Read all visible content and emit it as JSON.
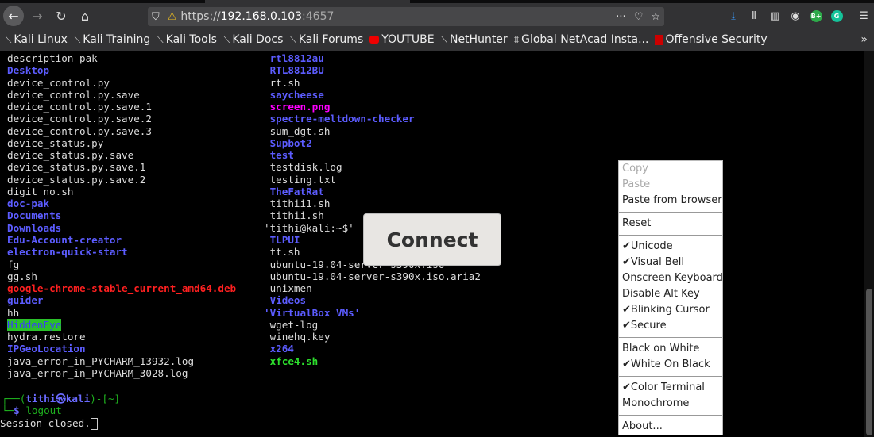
{
  "browser": {
    "url_scheme": "https://",
    "url_host": "192.168.0.103",
    "url_port": ":4657",
    "bookmarks": [
      {
        "label": "Kali Linux",
        "icon": "kali-icon"
      },
      {
        "label": "Kali Training",
        "icon": "kali-icon"
      },
      {
        "label": "Kali Tools",
        "icon": "kali-icon"
      },
      {
        "label": "Kali Docs",
        "icon": "kali-icon"
      },
      {
        "label": "Kali Forums",
        "icon": "kali-icon"
      },
      {
        "label": "YOUTUBE",
        "icon": "youtube-icon"
      },
      {
        "label": "NetHunter",
        "icon": "kali-icon"
      },
      {
        "label": "Global NetAcad Insta...",
        "icon": "netacad-icon"
      },
      {
        "label": "Offensive Security",
        "icon": "offsec-icon"
      }
    ]
  },
  "terminal": {
    "col1": [
      [
        "description-pak",
        ""
      ],
      [
        "Desktop",
        "dir"
      ],
      [
        "device_control.py",
        ""
      ],
      [
        "device_control.py.save",
        ""
      ],
      [
        "device_control.py.save.1",
        ""
      ],
      [
        "device_control.py.save.2",
        ""
      ],
      [
        "device_control.py.save.3",
        ""
      ],
      [
        "device_status.py",
        ""
      ],
      [
        "device_status.py.save",
        ""
      ],
      [
        "device_status.py.save.1",
        ""
      ],
      [
        "device_status.py.save.2",
        ""
      ],
      [
        "digit_no.sh",
        ""
      ],
      [
        "doc-pak",
        "dir"
      ],
      [
        "Documents",
        "dir"
      ],
      [
        "Downloads",
        "dir"
      ],
      [
        "Edu-Account-creator",
        "dir"
      ],
      [
        "electron-quick-start",
        "dir"
      ],
      [
        "fg",
        ""
      ],
      [
        "gg.sh",
        ""
      ],
      [
        "google-chrome-stable_current_amd64.deb",
        "red"
      ],
      [
        "guider",
        "dir"
      ],
      [
        "hh",
        ""
      ],
      [
        "HiddenEye",
        "hl"
      ],
      [
        "hydra.restore",
        ""
      ],
      [
        "IPGeoLocation",
        "dir"
      ],
      [
        "java_error_in_PYCHARM_13932.log",
        ""
      ],
      [
        "java_error_in_PYCHARM_3028.log",
        ""
      ]
    ],
    "col2": [
      [
        " rtl8812au",
        "dir"
      ],
      [
        " RTL8812BU",
        "dir"
      ],
      [
        " rt.sh",
        ""
      ],
      [
        " saycheese",
        "dir"
      ],
      [
        " screen.png",
        "img"
      ],
      [
        " spectre-meltdown-checker",
        "dir"
      ],
      [
        " sum_dgt.sh",
        ""
      ],
      [
        " Supbot2",
        "dir"
      ],
      [
        " test",
        "dir"
      ],
      [
        " testdisk.log",
        ""
      ],
      [
        " testing.txt",
        ""
      ],
      [
        " TheFatRat",
        "dir"
      ],
      [
        " tithii1.sh",
        ""
      ],
      [
        " tithii.sh",
        ""
      ],
      [
        "'tithi@kali:~$'",
        ""
      ],
      [
        " TLPUI",
        "dir"
      ],
      [
        " tt.sh",
        ""
      ],
      [
        " ubuntu-19.04-server-s390x.iso",
        ""
      ],
      [
        " ubuntu-19.04-server-s390x.iso.aria2",
        ""
      ],
      [
        " unixmen",
        ""
      ],
      [
        " Videos",
        "dir"
      ],
      [
        "'VirtualBox VMs'",
        "dir"
      ],
      [
        " wget-log",
        ""
      ],
      [
        " winehq.key",
        ""
      ],
      [
        " x264",
        "dir"
      ],
      [
        " xfce4.sh",
        "exe"
      ]
    ],
    "prompt_user": "tithi㉿kali",
    "prompt_dir": "~",
    "command": "logout",
    "session_closed": "Session closed."
  },
  "connect_label": "Connect",
  "menu": [
    {
      "label": "Copy",
      "disabled": true
    },
    {
      "label": "Paste",
      "disabled": true
    },
    {
      "label": "Paste from browser"
    },
    {
      "sep": true
    },
    {
      "label": "Reset"
    },
    {
      "sep": true
    },
    {
      "label": "Unicode",
      "checked": true
    },
    {
      "label": "Visual Bell",
      "checked": true
    },
    {
      "label": "Onscreen Keyboard"
    },
    {
      "label": "Disable Alt Key"
    },
    {
      "label": "Blinking Cursor",
      "checked": true
    },
    {
      "label": "Secure",
      "checked": true
    },
    {
      "sep": true
    },
    {
      "label": "Black on White"
    },
    {
      "label": "White On Black",
      "checked": true
    },
    {
      "sep": true
    },
    {
      "label": "Color Terminal",
      "checked": true
    },
    {
      "label": "Monochrome"
    },
    {
      "sep": true
    },
    {
      "label": "About..."
    }
  ]
}
